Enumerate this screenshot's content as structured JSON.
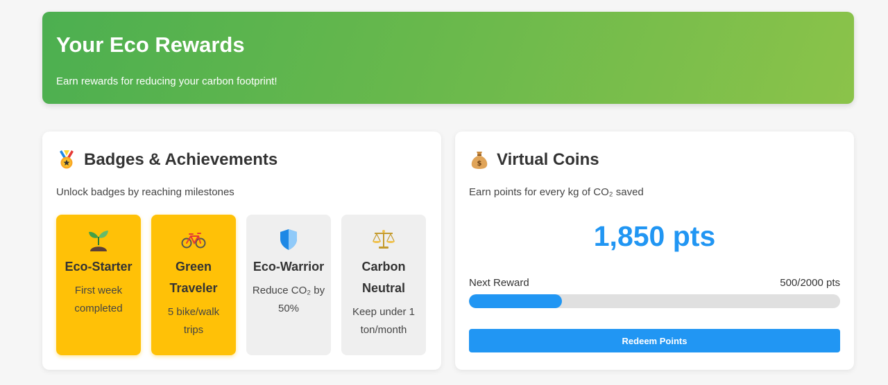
{
  "header": {
    "title": "Your Eco Rewards",
    "subtitle": "Earn rewards for reducing your carbon footprint!"
  },
  "badges_card": {
    "icon": "medal-icon",
    "title": "Badges & Achievements",
    "subtitle": "Unlock badges by reaching milestones",
    "badges": [
      {
        "icon": "seedling-icon",
        "name": "Eco-Starter",
        "description": "First week completed",
        "unlocked": true
      },
      {
        "icon": "bicycle-icon",
        "name": "Green Traveler",
        "description": "5 bike/walk trips",
        "unlocked": true
      },
      {
        "icon": "shield-icon",
        "name": "Eco-Warrior",
        "description": "Reduce CO₂ by 50%",
        "unlocked": false
      },
      {
        "icon": "scales-icon",
        "name": "Carbon Neutral",
        "description": "Keep under 1 ton/month",
        "unlocked": false
      }
    ]
  },
  "coins_card": {
    "icon": "money-bag-icon",
    "title": "Virtual Coins",
    "subtitle": "Earn points for every kg of CO₂ saved",
    "points": "1,850 pts",
    "next_reward_label": "Next Reward",
    "next_reward_value": "500/2000 pts",
    "progress_fraction": 0.25,
    "redeem_label": "Redeem Points"
  },
  "colors": {
    "accent_blue": "#2196f3",
    "badge_gold": "#ffc107",
    "header_green_start": "#4caf50",
    "header_green_end": "#8bc34a"
  }
}
